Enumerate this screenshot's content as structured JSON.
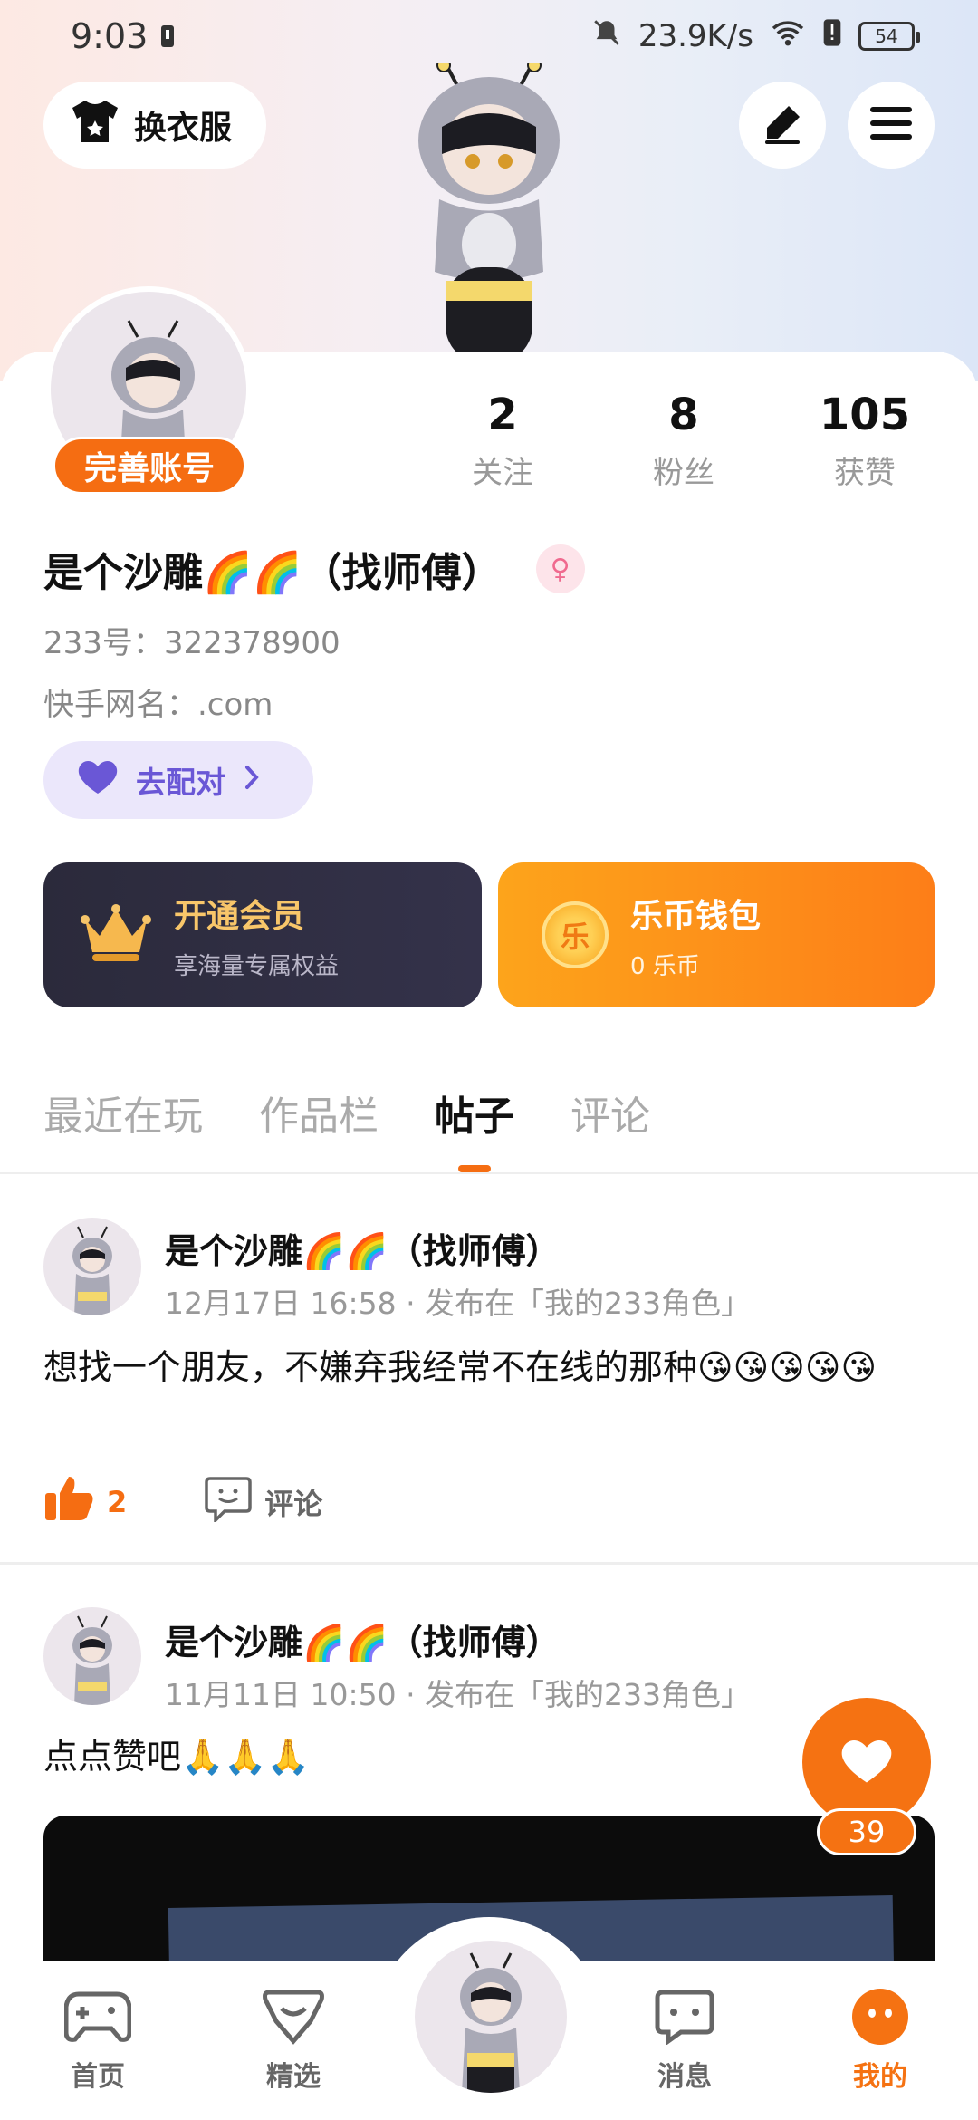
{
  "status_bar": {
    "time": "9:03",
    "speed": "23.9K/s",
    "battery": "54"
  },
  "header": {
    "dress_label": "换衣服"
  },
  "profile": {
    "complete_label": "完善账号",
    "username": "是个沙雕🌈🌈（找师傅）",
    "gender_symbol": "♀",
    "id_line": "233号：322378900",
    "ks_line": "快手网名：.com",
    "match_label": "去配对",
    "stats": [
      {
        "value": "2",
        "label": "关注"
      },
      {
        "value": "8",
        "label": "粉丝"
      },
      {
        "value": "105",
        "label": "获赞"
      }
    ]
  },
  "vip": {
    "title": "开通会员",
    "subtitle": "享海量专属权益"
  },
  "wallet": {
    "coin_glyph": "乐",
    "title": "乐币钱包",
    "subtitle": "0 乐币"
  },
  "tabs": [
    "最近在玩",
    "作品栏",
    "帖子",
    "评论"
  ],
  "posts": [
    {
      "author": "是个沙雕🌈🌈（找师傅）",
      "meta": "12月17日 16:58 · 发布在「我的233角色」",
      "text": "想找一个朋友，不嫌弃我经常不在线的那种😘😘😘😘😘",
      "likes": "2",
      "comment_label": "评论"
    },
    {
      "author": "是个沙雕🌈🌈（找师傅）",
      "meta": "11月11日 10:50 · 发布在「我的233角色」",
      "text": "点点赞吧🙏🙏🙏"
    }
  ],
  "fab": {
    "count": "39"
  },
  "bottom_nav": [
    {
      "label": "首页"
    },
    {
      "label": "精选"
    },
    {
      "label": "消息"
    },
    {
      "label": "我的"
    }
  ],
  "colors": {
    "accent": "#f57212",
    "vip_gold": "#f8c66a",
    "match_purple": "#6a57d6"
  }
}
